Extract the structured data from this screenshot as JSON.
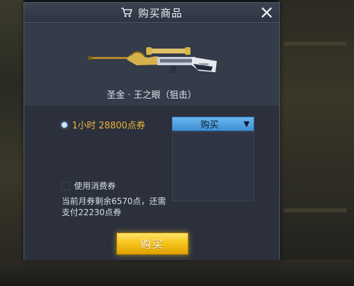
{
  "dialog": {
    "title": "购买商品",
    "title_icon": "cart-icon",
    "close_icon": "close-icon"
  },
  "item": {
    "name": "圣金 · 王之眼（狙击）",
    "image": "sniper-rifle-gold-dragon"
  },
  "purchase_option": {
    "selected": true,
    "label": "1小时 28800点券"
  },
  "buy_dropdown": {
    "label": "购买",
    "arrow": "▼"
  },
  "voucher": {
    "checked": false,
    "label": "使用消费券"
  },
  "info": {
    "line1": "当前月券剩余6570点，还需",
    "line2": "支付22230点券"
  },
  "buy_button": {
    "label": "购买"
  },
  "colors": {
    "price_text": "#f0b53a",
    "dropdown_blue": "#4a9be0",
    "buy_gold": "#f7c51e"
  }
}
